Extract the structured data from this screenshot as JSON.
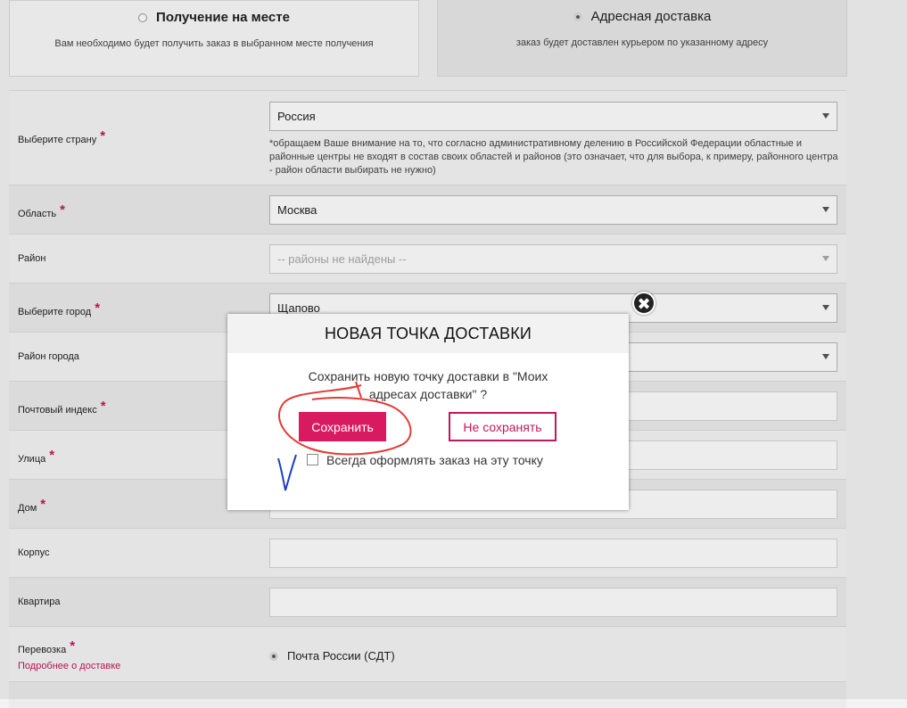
{
  "delivery_options": {
    "pickup": {
      "title": "Получение на месте",
      "description": "Вам необходимо будет получить заказ в выбранном месте получения",
      "selected": false
    },
    "address": {
      "title": "Адресная доставка",
      "description": "заказ будет доставлен курьером по указанному адресу",
      "selected": true
    }
  },
  "form": {
    "country": {
      "label": "Выберите страну",
      "required": "*",
      "value": "Россия",
      "note": "*обращаем Ваше внимание на то, что согласно административному делению в Российской Федерации областные и районные центры не входят в состав своих областей и районов (это означает, что для выбора, к примеру, районного центра - район области выбирать не нужно)"
    },
    "region": {
      "label": "Область",
      "required": "*",
      "value": "Москва"
    },
    "district": {
      "label": "Район",
      "value": "-- районы не найдены --"
    },
    "city": {
      "label": "Выберите город",
      "required": "*",
      "value": "Щапово"
    },
    "city_district": {
      "label": "Район города",
      "value": ""
    },
    "postal_code": {
      "label": "Почтовый индекс",
      "required": "*",
      "value": ""
    },
    "street": {
      "label": "Улица",
      "required": "*",
      "value": ""
    },
    "house": {
      "label": "Дом",
      "required": "*",
      "value": ""
    },
    "building": {
      "label": "Корпус",
      "value": ""
    },
    "apartment": {
      "label": "Квартира",
      "value": ""
    },
    "shipping": {
      "label": "Перевозка",
      "required": "*",
      "link": "Подробнее о доставке",
      "option": "Почта России (СДТ)"
    }
  },
  "modal": {
    "title": "НОВАЯ ТОЧКА ДОСТАВКИ",
    "message_line1": "Сохранить новую точку доставки в \"Моих",
    "message_line2": "адресах доставки\" ?",
    "save_label": "Сохранить",
    "nosave_label": "Не сохранять",
    "checkbox_label": "Всегда оформлять заказ на эту точку",
    "close_glyph": "✖"
  },
  "colors": {
    "accent": "#d81b60",
    "required": "#c2185b",
    "annotation_red": "#e53935",
    "annotation_blue": "#1e3fc9"
  }
}
